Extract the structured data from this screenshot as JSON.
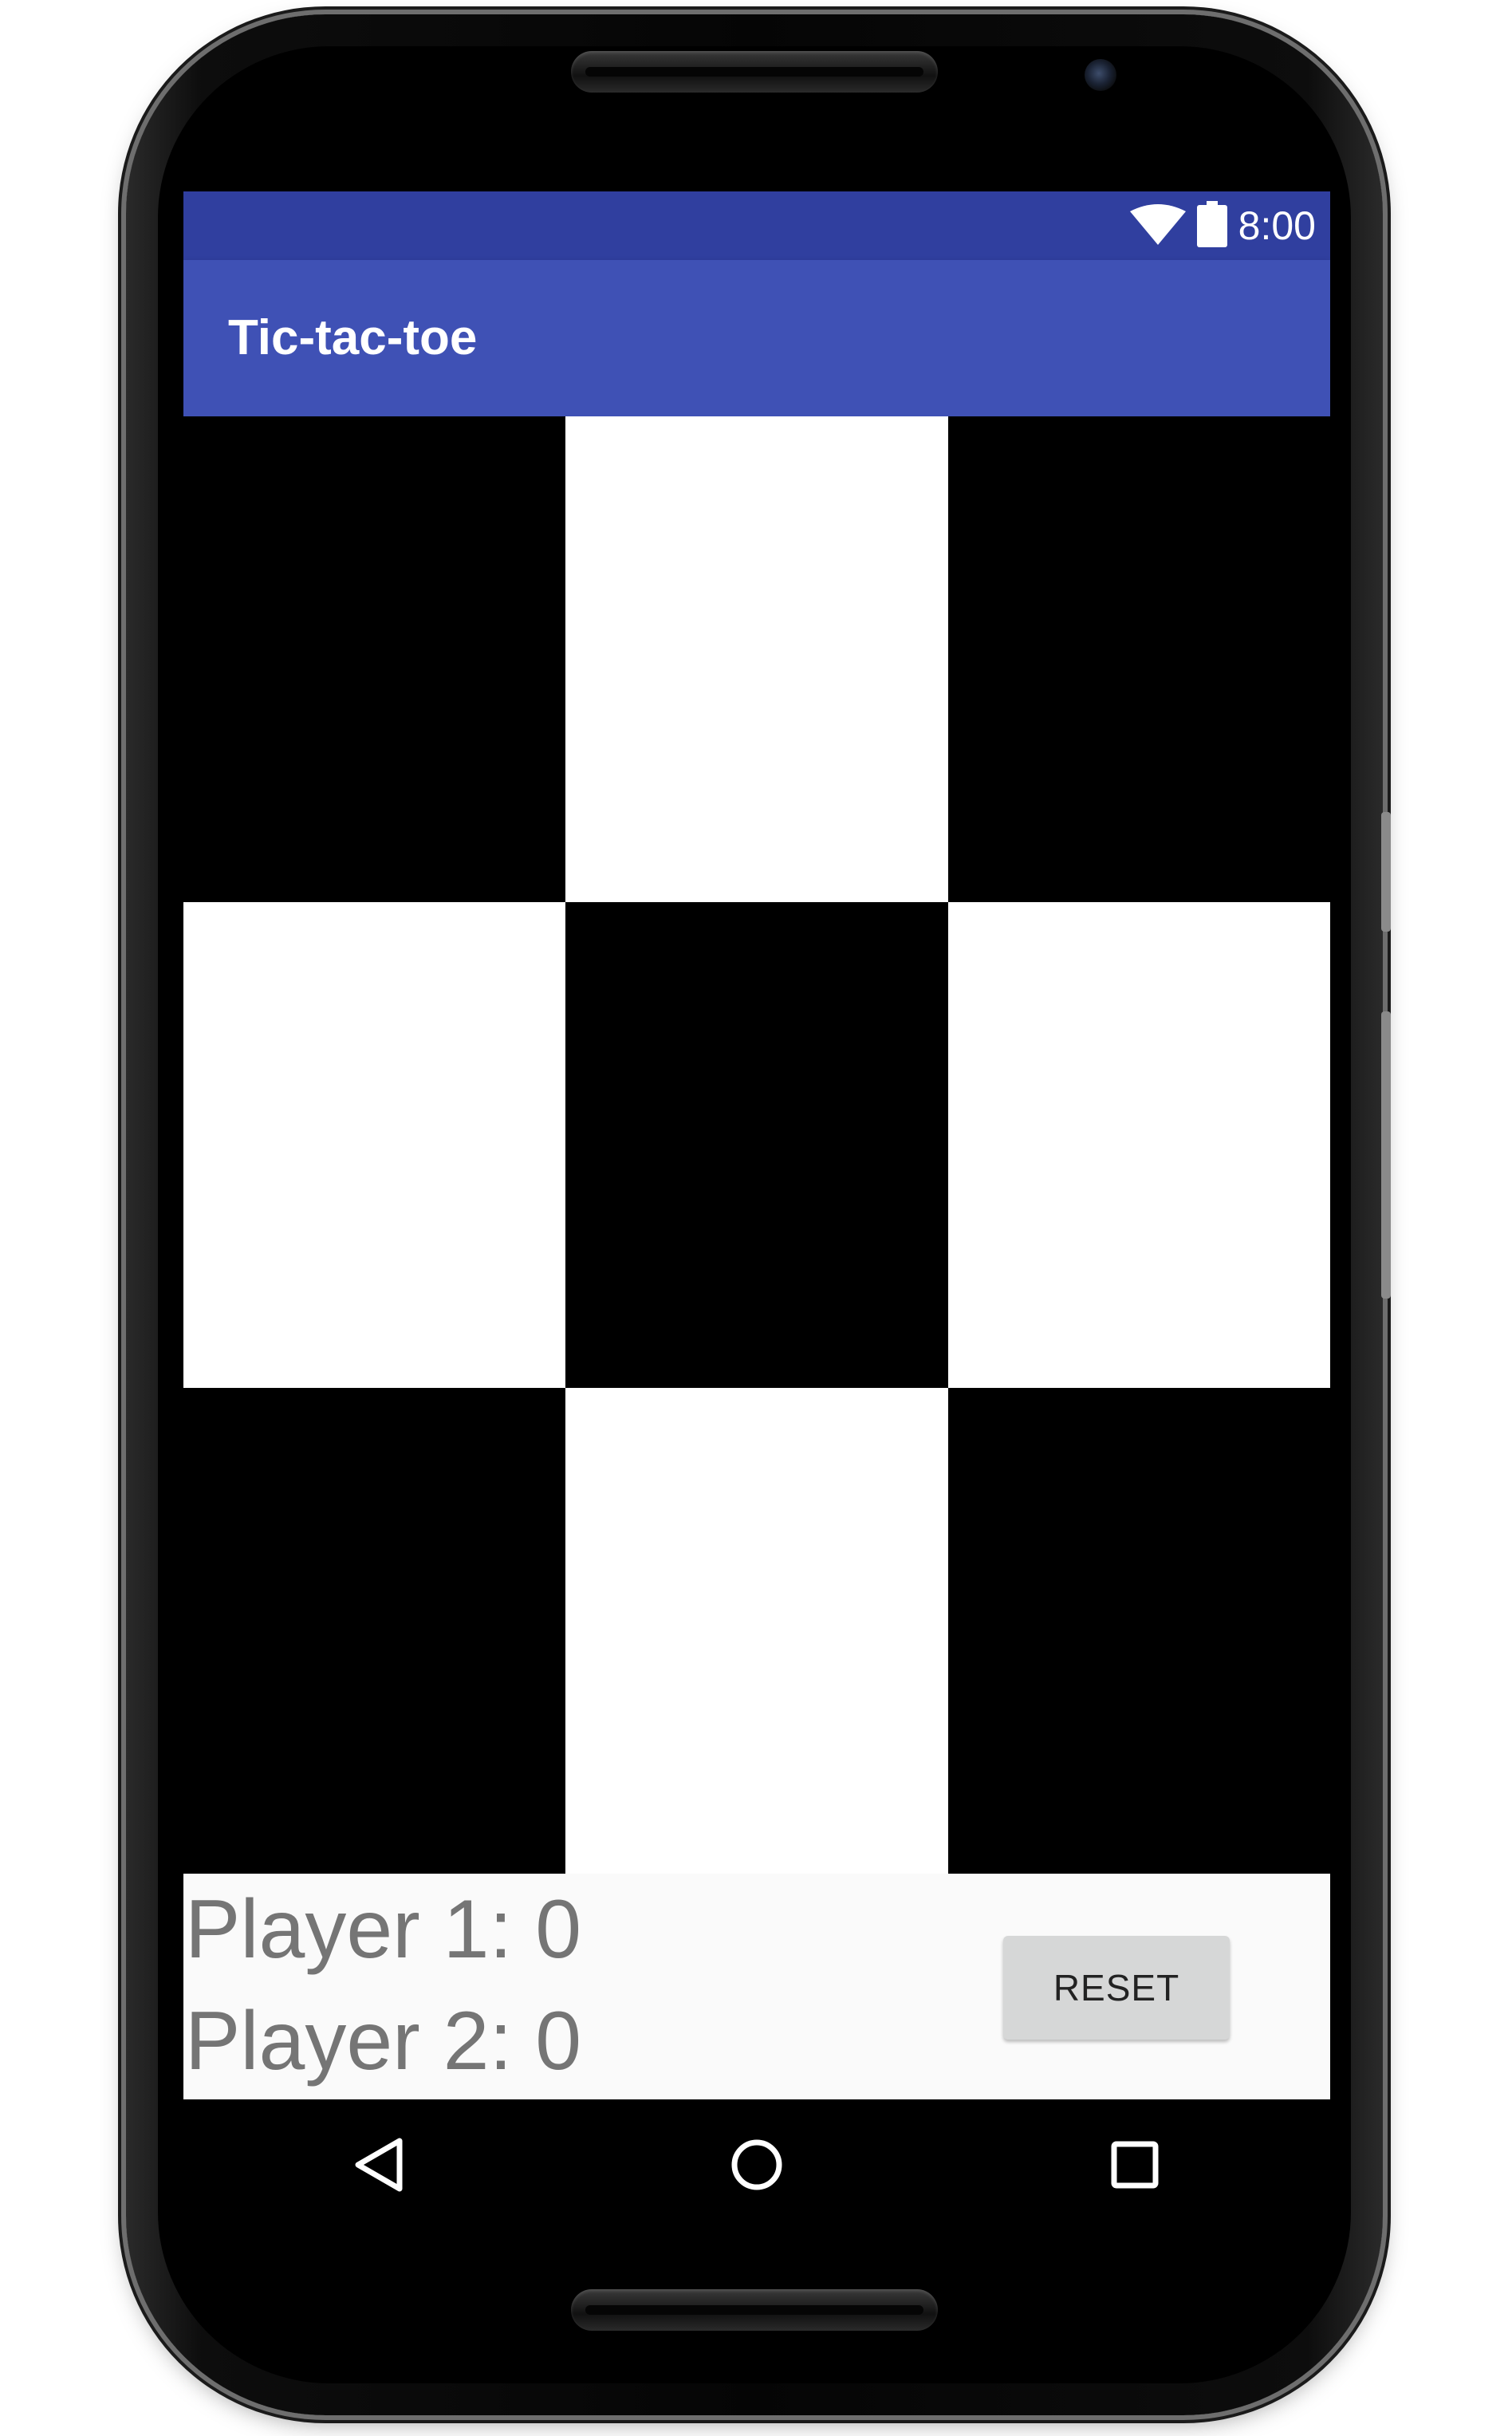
{
  "status_bar": {
    "time": "8:00",
    "icons": [
      "wifi-icon",
      "battery-icon"
    ],
    "background": "#303f9f"
  },
  "app_bar": {
    "title": "Tic-tac-toe",
    "background": "#3f51b5"
  },
  "board": {
    "rows": 3,
    "columns": 3,
    "cells": [
      {
        "row": 1,
        "col": 1,
        "color": "black"
      },
      {
        "row": 1,
        "col": 2,
        "color": "white"
      },
      {
        "row": 1,
        "col": 3,
        "color": "black"
      },
      {
        "row": 2,
        "col": 1,
        "color": "white"
      },
      {
        "row": 2,
        "col": 2,
        "color": "black"
      },
      {
        "row": 2,
        "col": 3,
        "color": "white"
      },
      {
        "row": 3,
        "col": 1,
        "color": "black"
      },
      {
        "row": 3,
        "col": 2,
        "color": "white"
      },
      {
        "row": 3,
        "col": 3,
        "color": "black"
      }
    ]
  },
  "scores": {
    "player1": "Player 1: 0",
    "player2": "Player 2: 0"
  },
  "reset_button": {
    "label": "RESET"
  },
  "nav_bar": {
    "buttons": [
      "back-triangle-icon",
      "home-circle-icon",
      "recents-square-icon"
    ]
  }
}
